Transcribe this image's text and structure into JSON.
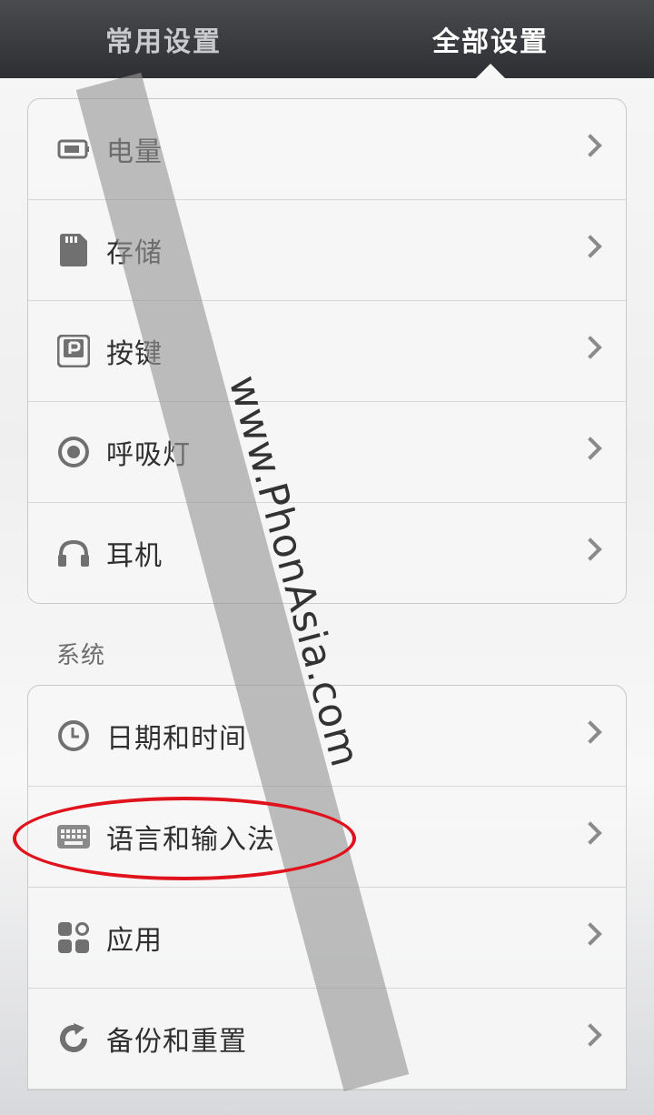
{
  "tabs": {
    "common": "常用设置",
    "all": "全部设置"
  },
  "group1": [
    {
      "label": "电量",
      "icon": "battery-icon"
    },
    {
      "label": "存储",
      "icon": "sd-card-icon"
    },
    {
      "label": "按键",
      "icon": "key-icon"
    },
    {
      "label": "呼吸灯",
      "icon": "breathing-light-icon"
    },
    {
      "label": "耳机",
      "icon": "headphones-icon"
    }
  ],
  "section_system": "系统",
  "group2": [
    {
      "label": "日期和时间",
      "icon": "clock-icon"
    },
    {
      "label": "语言和输入法",
      "icon": "keyboard-icon"
    },
    {
      "label": "应用",
      "icon": "apps-icon"
    },
    {
      "label": "备份和重置",
      "icon": "backup-icon"
    }
  ],
  "watermark": "www.PhonAsia.com",
  "colors": {
    "highlight": "#e0121c",
    "tabbar": "#3a3b3f"
  }
}
